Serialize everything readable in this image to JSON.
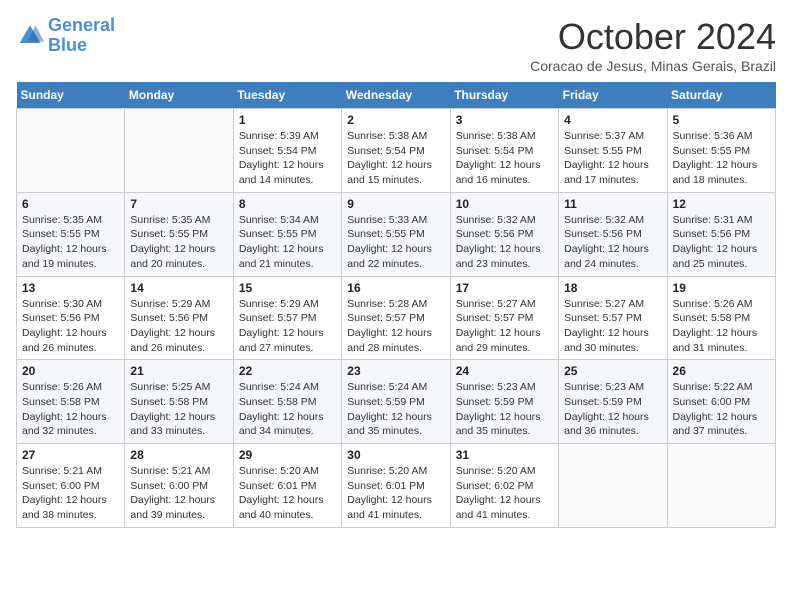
{
  "logo": {
    "line1": "General",
    "line2": "Blue"
  },
  "title": "October 2024",
  "subtitle": "Coracao de Jesus, Minas Gerais, Brazil",
  "days_of_week": [
    "Sunday",
    "Monday",
    "Tuesday",
    "Wednesday",
    "Thursday",
    "Friday",
    "Saturday"
  ],
  "weeks": [
    [
      {
        "day": "",
        "info": ""
      },
      {
        "day": "",
        "info": ""
      },
      {
        "day": "1",
        "info": "Sunrise: 5:39 AM\nSunset: 5:54 PM\nDaylight: 12 hours\nand 14 minutes."
      },
      {
        "day": "2",
        "info": "Sunrise: 5:38 AM\nSunset: 5:54 PM\nDaylight: 12 hours\nand 15 minutes."
      },
      {
        "day": "3",
        "info": "Sunrise: 5:38 AM\nSunset: 5:54 PM\nDaylight: 12 hours\nand 16 minutes."
      },
      {
        "day": "4",
        "info": "Sunrise: 5:37 AM\nSunset: 5:55 PM\nDaylight: 12 hours\nand 17 minutes."
      },
      {
        "day": "5",
        "info": "Sunrise: 5:36 AM\nSunset: 5:55 PM\nDaylight: 12 hours\nand 18 minutes."
      }
    ],
    [
      {
        "day": "6",
        "info": "Sunrise: 5:35 AM\nSunset: 5:55 PM\nDaylight: 12 hours\nand 19 minutes."
      },
      {
        "day": "7",
        "info": "Sunrise: 5:35 AM\nSunset: 5:55 PM\nDaylight: 12 hours\nand 20 minutes."
      },
      {
        "day": "8",
        "info": "Sunrise: 5:34 AM\nSunset: 5:55 PM\nDaylight: 12 hours\nand 21 minutes."
      },
      {
        "day": "9",
        "info": "Sunrise: 5:33 AM\nSunset: 5:55 PM\nDaylight: 12 hours\nand 22 minutes."
      },
      {
        "day": "10",
        "info": "Sunrise: 5:32 AM\nSunset: 5:56 PM\nDaylight: 12 hours\nand 23 minutes."
      },
      {
        "day": "11",
        "info": "Sunrise: 5:32 AM\nSunset: 5:56 PM\nDaylight: 12 hours\nand 24 minutes."
      },
      {
        "day": "12",
        "info": "Sunrise: 5:31 AM\nSunset: 5:56 PM\nDaylight: 12 hours\nand 25 minutes."
      }
    ],
    [
      {
        "day": "13",
        "info": "Sunrise: 5:30 AM\nSunset: 5:56 PM\nDaylight: 12 hours\nand 26 minutes."
      },
      {
        "day": "14",
        "info": "Sunrise: 5:29 AM\nSunset: 5:56 PM\nDaylight: 12 hours\nand 26 minutes."
      },
      {
        "day": "15",
        "info": "Sunrise: 5:29 AM\nSunset: 5:57 PM\nDaylight: 12 hours\nand 27 minutes."
      },
      {
        "day": "16",
        "info": "Sunrise: 5:28 AM\nSunset: 5:57 PM\nDaylight: 12 hours\nand 28 minutes."
      },
      {
        "day": "17",
        "info": "Sunrise: 5:27 AM\nSunset: 5:57 PM\nDaylight: 12 hours\nand 29 minutes."
      },
      {
        "day": "18",
        "info": "Sunrise: 5:27 AM\nSunset: 5:57 PM\nDaylight: 12 hours\nand 30 minutes."
      },
      {
        "day": "19",
        "info": "Sunrise: 5:26 AM\nSunset: 5:58 PM\nDaylight: 12 hours\nand 31 minutes."
      }
    ],
    [
      {
        "day": "20",
        "info": "Sunrise: 5:26 AM\nSunset: 5:58 PM\nDaylight: 12 hours\nand 32 minutes."
      },
      {
        "day": "21",
        "info": "Sunrise: 5:25 AM\nSunset: 5:58 PM\nDaylight: 12 hours\nand 33 minutes."
      },
      {
        "day": "22",
        "info": "Sunrise: 5:24 AM\nSunset: 5:58 PM\nDaylight: 12 hours\nand 34 minutes."
      },
      {
        "day": "23",
        "info": "Sunrise: 5:24 AM\nSunset: 5:59 PM\nDaylight: 12 hours\nand 35 minutes."
      },
      {
        "day": "24",
        "info": "Sunrise: 5:23 AM\nSunset: 5:59 PM\nDaylight: 12 hours\nand 35 minutes."
      },
      {
        "day": "25",
        "info": "Sunrise: 5:23 AM\nSunset: 5:59 PM\nDaylight: 12 hours\nand 36 minutes."
      },
      {
        "day": "26",
        "info": "Sunrise: 5:22 AM\nSunset: 6:00 PM\nDaylight: 12 hours\nand 37 minutes."
      }
    ],
    [
      {
        "day": "27",
        "info": "Sunrise: 5:21 AM\nSunset: 6:00 PM\nDaylight: 12 hours\nand 38 minutes."
      },
      {
        "day": "28",
        "info": "Sunrise: 5:21 AM\nSunset: 6:00 PM\nDaylight: 12 hours\nand 39 minutes."
      },
      {
        "day": "29",
        "info": "Sunrise: 5:20 AM\nSunset: 6:01 PM\nDaylight: 12 hours\nand 40 minutes."
      },
      {
        "day": "30",
        "info": "Sunrise: 5:20 AM\nSunset: 6:01 PM\nDaylight: 12 hours\nand 41 minutes."
      },
      {
        "day": "31",
        "info": "Sunrise: 5:20 AM\nSunset: 6:02 PM\nDaylight: 12 hours\nand 41 minutes."
      },
      {
        "day": "",
        "info": ""
      },
      {
        "day": "",
        "info": ""
      }
    ]
  ]
}
